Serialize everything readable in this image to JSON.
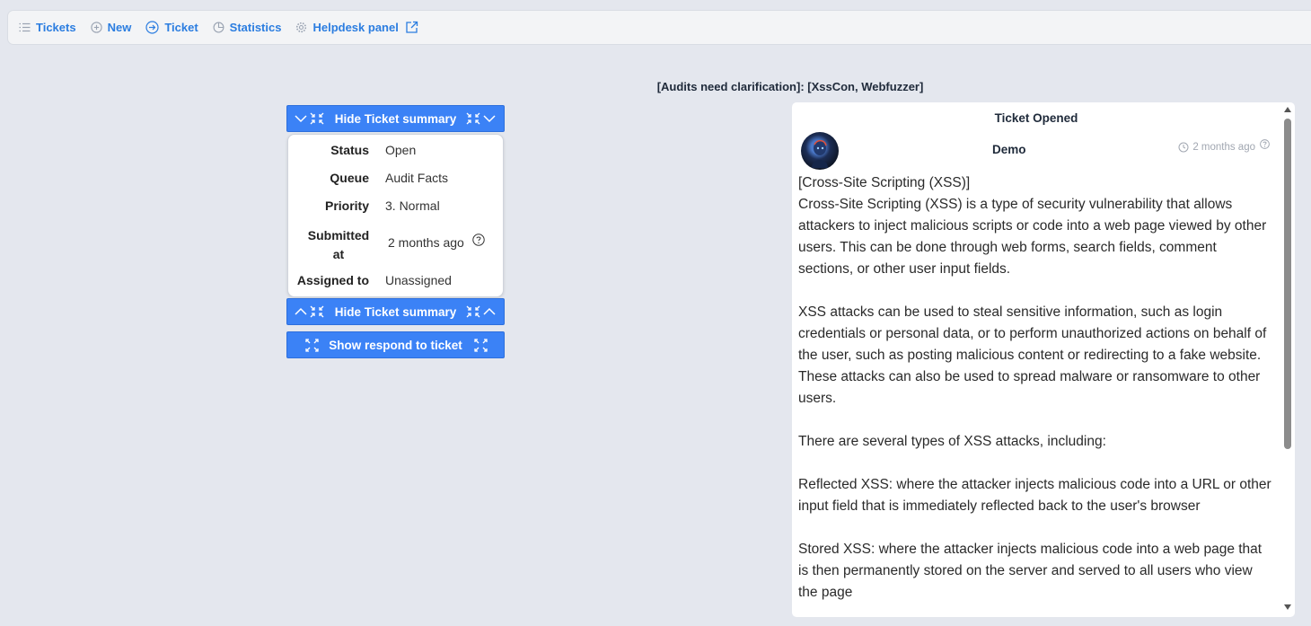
{
  "nav": {
    "items": [
      {
        "label": "Tickets",
        "icon": "list-icon"
      },
      {
        "label": "New",
        "icon": "plus-circle-icon"
      },
      {
        "label": "Ticket",
        "icon": "arrow-right-circle-icon"
      },
      {
        "label": "Statistics",
        "icon": "pie-chart-icon"
      },
      {
        "label": "Helpdesk panel",
        "icon": "gear-icon"
      }
    ]
  },
  "ticket": {
    "title": "[Audits need clarification]: [XssCon, Webfuzzer]"
  },
  "summary": {
    "hide_label": "Hide Ticket summary",
    "show_respond_label": "Show respond to ticket",
    "rows": [
      {
        "key": "Status",
        "value": "Open"
      },
      {
        "key": "Queue",
        "value": "Audit Facts"
      },
      {
        "key": "Priority",
        "value": "3. Normal"
      },
      {
        "key": "Submitted at",
        "value": "2 months ago"
      },
      {
        "key": "Assigned to",
        "value": "Unassigned"
      }
    ]
  },
  "message": {
    "header": "Ticket Opened",
    "author": "Demo",
    "time": "2 months ago",
    "paragraphs": [
      "[Cross-Site Scripting (XSS)]\nCross-Site Scripting (XSS) is a type of security vulnerability that allows attackers to inject malicious scripts or code into a web page viewed by other users. This can be done through web forms, search fields, comment sections, or other user input fields.",
      "XSS attacks can be used to steal sensitive information, such as login credentials or personal data, or to perform unauthorized actions on behalf of the user, such as posting malicious content or redirecting to a fake website. These attacks can also be used to spread malware or ransomware to other users.",
      "There are several types of XSS attacks, including:",
      "Reflected XSS: where the attacker injects malicious code into a URL or other input field that is immediately reflected back to the user's browser",
      "Stored XSS: where the attacker injects malicious code into a web page that is then permanently stored on the server and served to all users who view the page"
    ]
  },
  "colors": {
    "accent": "#3b82f6",
    "link": "#2b7de0",
    "background": "#e4e7ee"
  }
}
